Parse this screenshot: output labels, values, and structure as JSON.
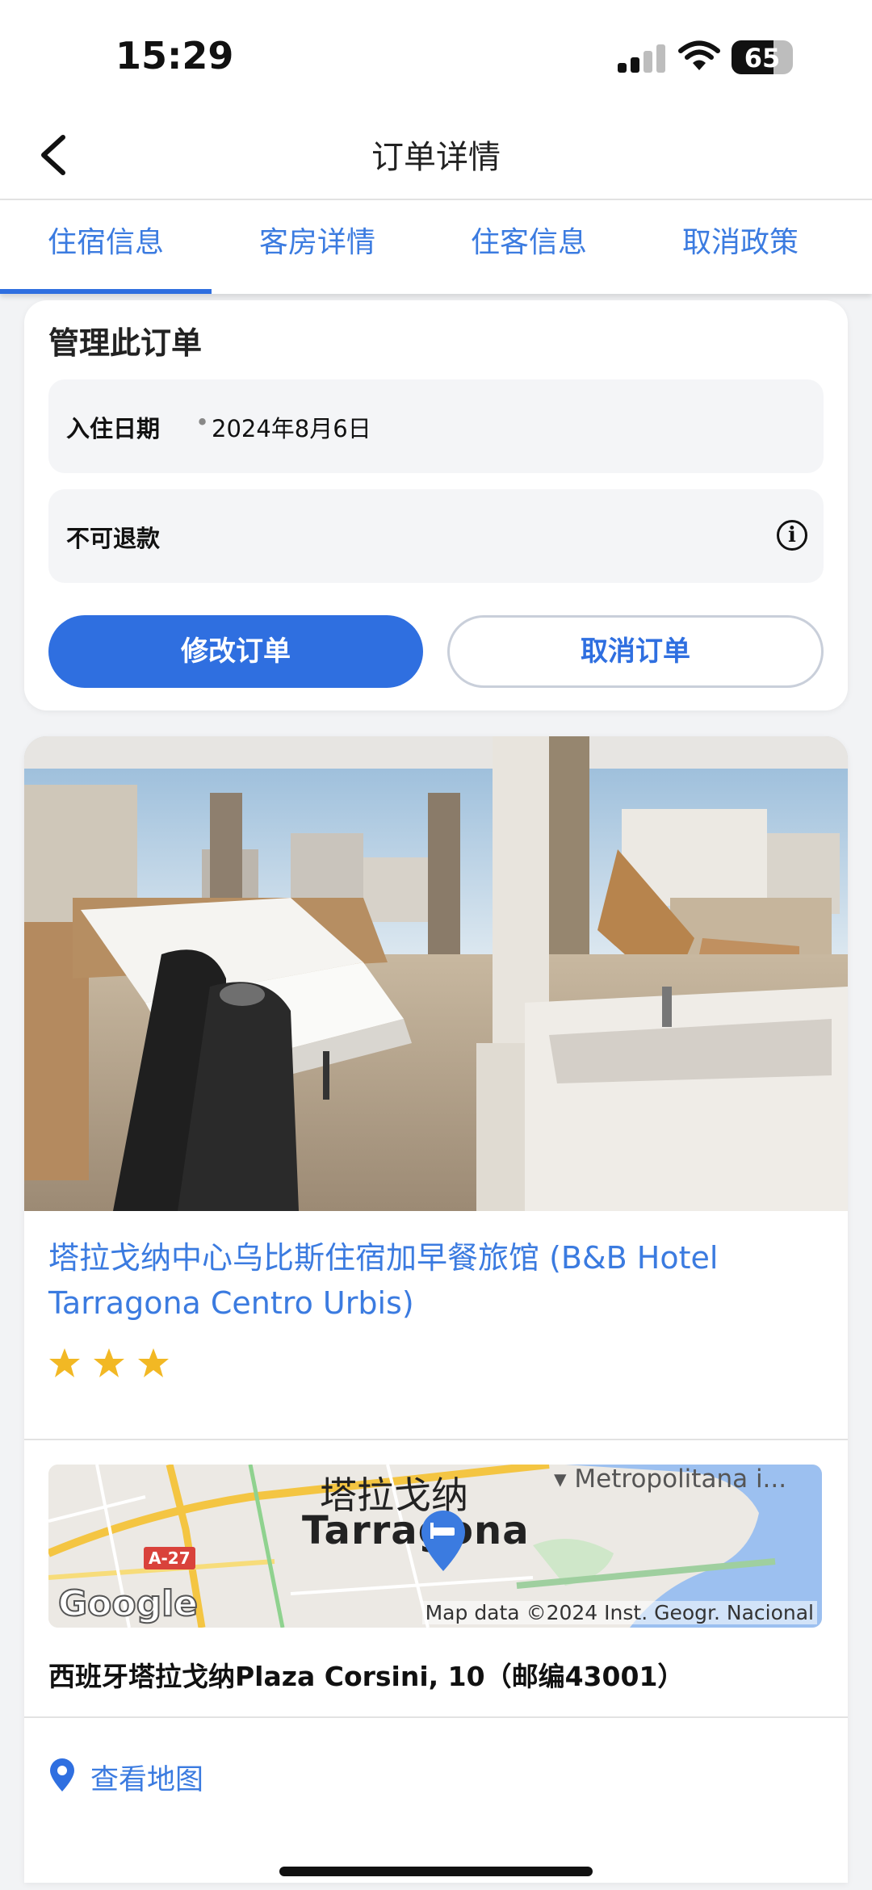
{
  "status_bar": {
    "time": "15:29",
    "battery": "65"
  },
  "header": {
    "title": "订单详情"
  },
  "tabs": [
    {
      "label": "住宿信息",
      "active": true
    },
    {
      "label": "客房详情",
      "active": false
    },
    {
      "label": "住客信息",
      "active": false
    },
    {
      "label": "取消政策",
      "active": false
    }
  ],
  "manage": {
    "title": "管理此订单",
    "checkin_label": "入住日期",
    "checkin_sep": "•",
    "checkin_value": "2024年8月6日",
    "refund_label": "不可退款",
    "modify_label": "修改订单",
    "cancel_label": "取消订单"
  },
  "hotel": {
    "name": "塔拉戈纳中心乌比斯住宿加早餐旅馆 (B&B Hotel Tarragona Centro Urbis)",
    "stars": 3,
    "map": {
      "city_cn": "塔拉戈纳",
      "city_en": "Tarragona",
      "poi": "Metropolitana i...",
      "road": "A-27",
      "logo": "Google",
      "credit": "Map data ©2024 Inst. Geogr. Nacional"
    },
    "address": "西班牙塔拉戈纳Plaza Corsini, 10（邮编43001）",
    "view_map_label": "查看地图"
  },
  "colors": {
    "accent": "#2f6fe0",
    "link": "#3b7be0",
    "star": "#f2b824"
  }
}
